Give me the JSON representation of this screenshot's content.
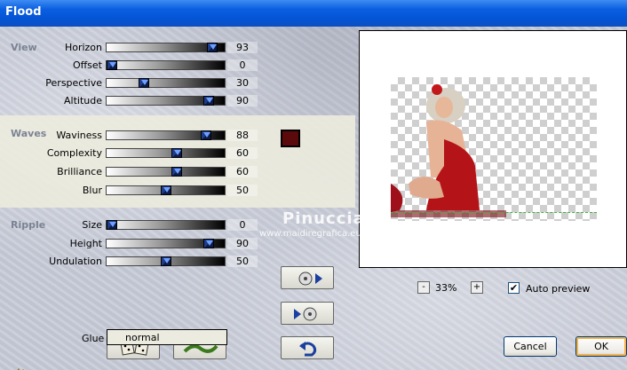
{
  "window": {
    "title": "Flood"
  },
  "sections": {
    "view": "View",
    "waves": "Waves",
    "ripple": "Ripple"
  },
  "params": {
    "horizon": {
      "label": "Horizon",
      "value": "93",
      "level": 0.93
    },
    "offset": {
      "label": "Offset",
      "value": "0",
      "level": 0.0
    },
    "perspective": {
      "label": "Perspective",
      "value": "30",
      "level": 0.3
    },
    "altitude": {
      "label": "Altitude",
      "value": "90",
      "level": 0.9
    },
    "waviness": {
      "label": "Waviness",
      "value": "88",
      "level": 0.88
    },
    "complexity": {
      "label": "Complexity",
      "value": "60",
      "level": 0.6
    },
    "brilliance": {
      "label": "Brilliance",
      "value": "60",
      "level": 0.6
    },
    "blur": {
      "label": "Blur",
      "value": "50",
      "level": 0.5
    },
    "size": {
      "label": "Size",
      "value": "0",
      "level": 0.0
    },
    "height": {
      "label": "Height",
      "value": "90",
      "level": 0.9
    },
    "undulation": {
      "label": "Undulation",
      "value": "50",
      "level": 0.5
    }
  },
  "colors": {
    "wave_color": "#5a0a0a",
    "title_bar": "#0a5fe0",
    "accent": "#f2b24e"
  },
  "preview": {
    "watermark_name": "Pinuccia",
    "watermark_url": "www.maidiregrafica.eu",
    "zoom": "33%",
    "zoom_minus": "-",
    "zoom_plus": "+",
    "auto_preview_label": "Auto preview",
    "auto_preview_checked": "✔"
  },
  "glue": {
    "label": "Glue",
    "value": "normal"
  },
  "buttons": {
    "cancel": "Cancel",
    "ok": "OK"
  },
  "icons": {
    "randomize": "dice-icon",
    "wave": "wave-icon",
    "play_right": "play-right-icon",
    "play_left": "play-left-icon",
    "reset": "reset-arrow-icon",
    "logo": "app-logo-icon"
  }
}
